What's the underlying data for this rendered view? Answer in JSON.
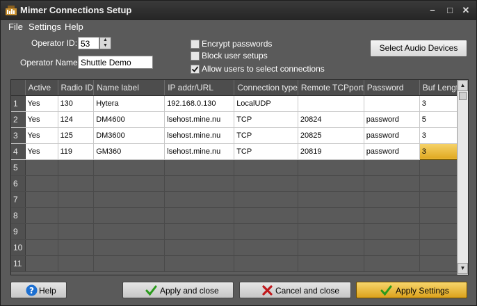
{
  "window": {
    "title": "Mimer Connections Setup",
    "controls": {
      "minimize": "–",
      "maximize": "□",
      "close": "✕"
    }
  },
  "menu": {
    "items": [
      "File",
      "Settings",
      "Help"
    ]
  },
  "form": {
    "operator_id_label": "Operator ID:",
    "operator_id_value": "53",
    "operator_name_label": "Operator Name:",
    "operator_name_value": "Shuttle Demo",
    "checkboxes": [
      {
        "label": "Encrypt passwords",
        "checked": false
      },
      {
        "label": "Block user setups",
        "checked": false
      },
      {
        "label": "Allow users to select connections",
        "checked": true
      }
    ],
    "select_audio_label": "Select Audio Devices"
  },
  "grid": {
    "columns": [
      "",
      "Active",
      "Radio ID",
      "Name label",
      "IP addr/URL",
      "Connection type",
      "Remote TCPport",
      "Password",
      "Buf Length"
    ],
    "rows": [
      [
        "1",
        "Yes",
        "130",
        "Hytera",
        "192.168.0.130",
        "LocalUDP",
        "",
        "",
        "3"
      ],
      [
        "2",
        "Yes",
        "124",
        "DM4600",
        "lsehost.mine.nu",
        "TCP",
        "20824",
        "password",
        "5"
      ],
      [
        "3",
        "Yes",
        "125",
        "DM3600",
        "lsehost.mine.nu",
        "TCP",
        "20825",
        "password",
        "3"
      ],
      [
        "4",
        "Yes",
        "119",
        "GM360",
        "lsehost.mine.nu",
        "TCP",
        "20819",
        "password",
        "3"
      ]
    ],
    "empty_rows": [
      "5",
      "6",
      "7",
      "8",
      "9",
      "10",
      "11"
    ]
  },
  "buttons": {
    "help": "Help",
    "apply_close": "Apply and close",
    "cancel_close": "Cancel and close",
    "apply_settings": "Apply Settings"
  },
  "colors": {
    "accent_gold": "#e0a820",
    "background": "#5a5a5a",
    "titlebar": "#2b2b2b"
  }
}
